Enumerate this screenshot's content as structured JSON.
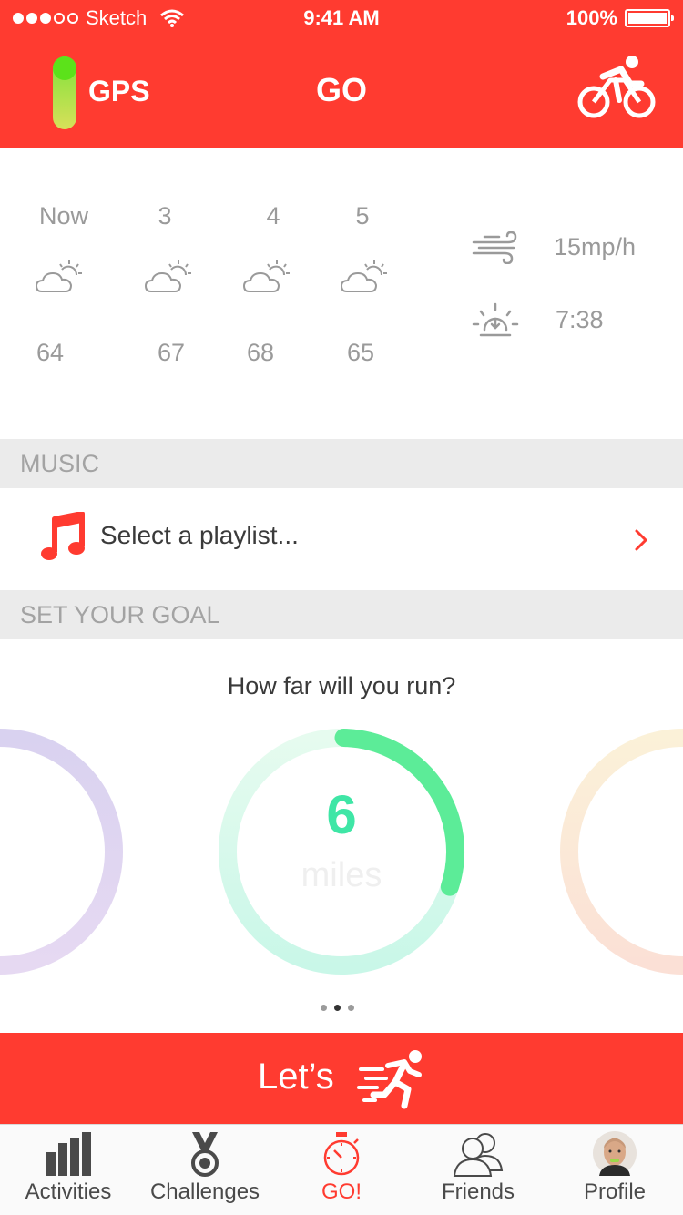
{
  "status_bar": {
    "carrier": "Sketch",
    "time": "9:41 AM",
    "battery": "100%"
  },
  "nav": {
    "gps_label": "GPS",
    "title": "GO",
    "activity_icon": "bicycle-icon"
  },
  "weather": {
    "forecast": [
      {
        "label": "Now",
        "temp": "64",
        "icon": "partly-cloudy-icon"
      },
      {
        "label": "3",
        "temp": "67",
        "icon": "partly-cloudy-icon"
      },
      {
        "label": "4",
        "temp": "68",
        "icon": "partly-cloudy-icon"
      },
      {
        "label": "5",
        "temp": "65",
        "icon": "partly-cloudy-icon"
      }
    ],
    "wind": "15mp/h",
    "sunrise": "7:38"
  },
  "music": {
    "header": "MUSIC",
    "playlist_prompt": "Select a playlist..."
  },
  "goal": {
    "header": "SET YOUR GOAL",
    "question": "How far will you run?",
    "value": "6",
    "unit": "miles",
    "progress_fraction": 0.3,
    "page_index": 1,
    "page_count": 3
  },
  "start_button": {
    "label": "Let’s",
    "icon": "runner-icon"
  },
  "tabs": [
    {
      "label": "Activities",
      "icon": "bar-chart-icon"
    },
    {
      "label": "Challenges",
      "icon": "medal-icon"
    },
    {
      "label": "GO!",
      "icon": "stopwatch-icon",
      "active": true
    },
    {
      "label": "Friends",
      "icon": "friends-icon"
    },
    {
      "label": "Profile",
      "icon": "avatar"
    }
  ],
  "colors": {
    "primary_red": "#ff3b30",
    "goal_green": "#3fe6a6",
    "text_gray": "#9a9a9a"
  }
}
